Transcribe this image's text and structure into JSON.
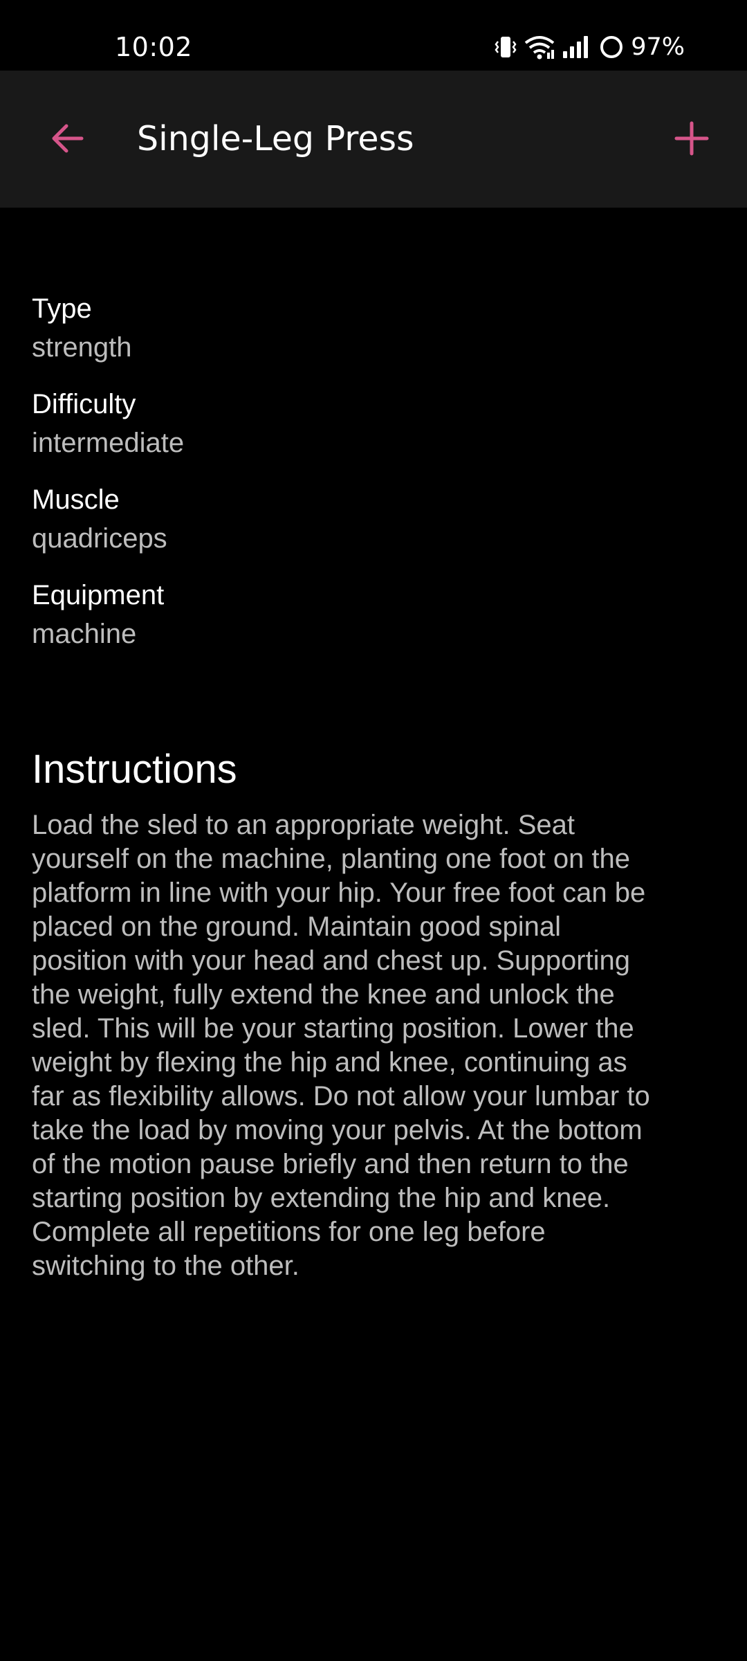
{
  "status_bar": {
    "time": "10:02",
    "battery": "97%",
    "icons": [
      "vibrate-icon",
      "wifi-icon",
      "signal-icon",
      "battery-icon"
    ]
  },
  "app_bar": {
    "title": "Single-Leg Press",
    "back_icon": "arrow-back-icon",
    "add_icon": "plus-icon"
  },
  "colors": {
    "accent": "#d6558a",
    "background": "#000000",
    "app_bar": "#191919",
    "secondary_text": "#bdbdbd"
  },
  "details": [
    {
      "label": "Type",
      "value": "strength"
    },
    {
      "label": "Difficulty",
      "value": "intermediate"
    },
    {
      "label": "Muscle",
      "value": "quadriceps"
    },
    {
      "label": "Equipment",
      "value": "machine"
    }
  ],
  "instructions": {
    "heading": "Instructions",
    "text": "Load the sled to an appropriate weight. Seat yourself on the machine, planting one foot on the platform in line with your hip. Your free foot can be placed on the ground. Maintain good spinal position with your head and chest up. Supporting the weight, fully extend the knee and unlock the sled. This will be your starting position. Lower the weight by flexing the hip and knee, continuing as far as flexibility allows. Do not allow your lumbar to take the load by moving your pelvis. At the bottom of the motion pause briefly and then return to the starting position by extending the hip and knee. Complete all repetitions for one leg before switching to the other."
  }
}
